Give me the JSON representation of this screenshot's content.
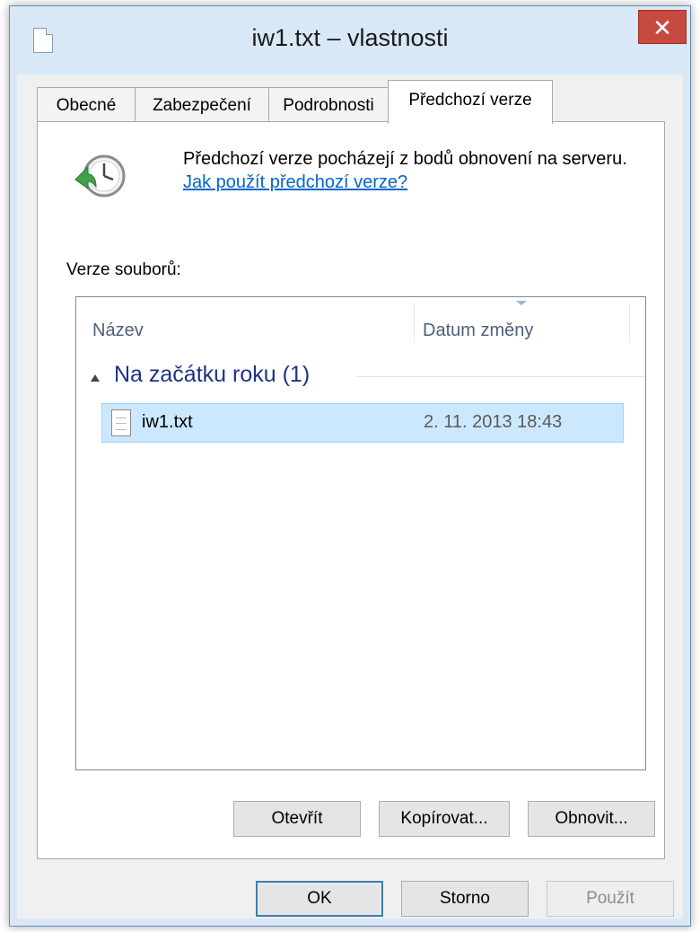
{
  "window": {
    "title": "iw1.txt – vlastnosti"
  },
  "icons": {
    "close": "close-icon",
    "document": "document-icon",
    "restore": "clock-restore-icon",
    "file": "text-file-icon"
  },
  "tabs": [
    {
      "label": "Obecné",
      "active": false
    },
    {
      "label": "Zabezpečení",
      "active": false
    },
    {
      "label": "Podrobnosti",
      "active": false
    },
    {
      "label": "Předchozí verze",
      "active": true
    }
  ],
  "info": {
    "text": "Předchozí verze pocházejí z bodů obnovení na serveru.",
    "link": "Jak použít předchozí verze?"
  },
  "versions": {
    "label": "Verze souborů:",
    "columns": {
      "name": "Název",
      "date": "Datum změny"
    },
    "group": {
      "title": "Na začátku roku (1)"
    },
    "rows": [
      {
        "name": "iw1.txt",
        "date": "2. 11. 2013 18:43",
        "selected": true
      }
    ]
  },
  "actions": {
    "open": "Otevřít",
    "copy": "Kopírovat...",
    "restore": "Obnovit..."
  },
  "dialog": {
    "ok": "OK",
    "cancel": "Storno",
    "apply": "Použít"
  },
  "colors": {
    "accent": "#3c7fb1",
    "selection": "#cce8ff",
    "link": "#0066cc",
    "close": "#c74a3f"
  }
}
